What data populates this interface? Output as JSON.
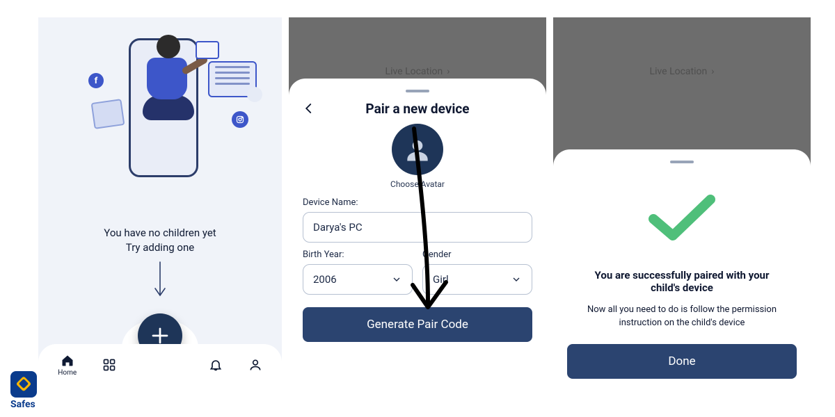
{
  "screen1": {
    "empty_title": "You have no children yet",
    "empty_sub": "Try adding one",
    "tabs": {
      "home": "Home"
    }
  },
  "screen2": {
    "dim_label": "Live Location",
    "sheet_title": "Pair a new device",
    "avatar_label": "Choose Avatar",
    "device_name_label": "Device Name:",
    "device_name_value": "Darya's PC",
    "birth_year_label": "Birth Year:",
    "birth_year_value": "2006",
    "gender_label": "Gender",
    "gender_value": "Girl",
    "cta": "Generate Pair Code"
  },
  "screen3": {
    "dim_label": "Live Location",
    "heading": "You are successfully paired with your child's device",
    "sub": "Now all you need to do is follow the permission instruction on the child's device",
    "cta": "Done"
  },
  "app": {
    "name": "Safes"
  }
}
